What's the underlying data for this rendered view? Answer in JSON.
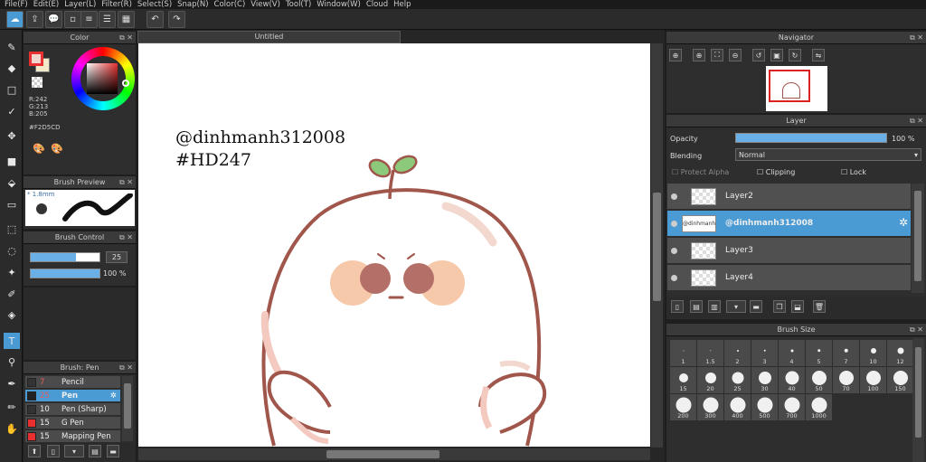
{
  "menu": [
    "File(F)",
    "Edit(E)",
    "Layer(L)",
    "Filter(R)",
    "Select(S)",
    "Snap(N)",
    "Color(C)",
    "View(V)",
    "Tool(T)",
    "Window(W)",
    "Cloud",
    "Help"
  ],
  "canvas_tab": "Untitled",
  "color_panel": {
    "title": "Color",
    "r": "R:242",
    "g": "G:213",
    "b": "B:205",
    "hex": "#F2D5CD",
    "fg": "#F2D5CD",
    "bg": "#F2E9C8"
  },
  "brush_preview": {
    "title": "Brush Preview",
    "size": "1.8mm"
  },
  "brush_control": {
    "title": "Brush Control",
    "size": "25",
    "size_fill": 0.66,
    "opacity": "100 %",
    "opacity_fill": 1.0
  },
  "brush_panel": {
    "title": "Brush: Pen",
    "items": [
      {
        "num": "7",
        "name": "Pencil",
        "color": "#333333"
      },
      {
        "num": "25",
        "name": "Pen",
        "color": "#222222",
        "selected": true
      },
      {
        "num": "10",
        "name": "Pen (Sharp)",
        "color": "#333333"
      },
      {
        "num": "15",
        "name": "G Pen",
        "color": "#e83030"
      },
      {
        "num": "15",
        "name": "Mapping Pen",
        "color": "#e83030"
      }
    ]
  },
  "navigator": {
    "title": "Navigator"
  },
  "layer_panel": {
    "title": "Layer",
    "opacity_label": "Opacity",
    "opacity": "100 %",
    "opacity_fill": 1.0,
    "blending_label": "Blending",
    "blending": "Normal",
    "protect_alpha": "Protect Alpha",
    "clipping": "Clipping",
    "lock": "Lock",
    "layers": [
      {
        "name": "Layer2"
      },
      {
        "name": "@dinhmanh312008",
        "selected": true
      },
      {
        "name": "Layer3"
      },
      {
        "name": "Layer4"
      }
    ]
  },
  "brush_size": {
    "title": "Brush Size",
    "sizes": [
      "1",
      "1.5",
      "2",
      "3",
      "4",
      "5",
      "7",
      "10",
      "12",
      "15",
      "20",
      "25",
      "30",
      "40",
      "50",
      "70",
      "100",
      "150",
      "200",
      "300",
      "400",
      "500",
      "700",
      "1000"
    ]
  },
  "canvas_text": {
    "line1": "@dinhmanh312008",
    "line2": "#HD247"
  },
  "colors": {
    "accent": "#4a9ad4",
    "outline": "#a0564a",
    "cheek": "#f6c9ab",
    "eye": "#b47068",
    "leaf": "#8cc97a"
  }
}
